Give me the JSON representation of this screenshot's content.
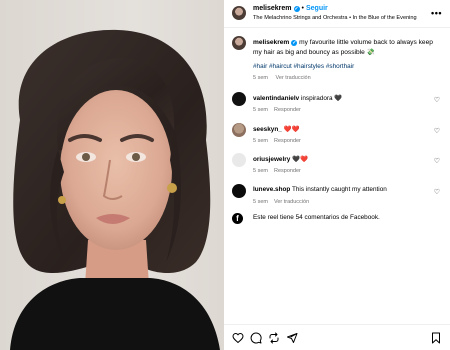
{
  "header": {
    "username": "melisekrem",
    "follow_label": "Seguir",
    "audio": "The Melachrino Strings and Orchestra • In the Blue of the Evening",
    "more_label": "•••"
  },
  "caption": {
    "username": "melisekrem",
    "text": "my favourite little volume back to always keep my hair as big and bouncy as possible 💸",
    "hashtags": "#hair #haircut #hairstyles #shorthair",
    "time": "5 sem",
    "translate": "Ver traducción"
  },
  "comments": [
    {
      "username": "valentindanielv",
      "text": "inspiradora 🖤",
      "time": "5 sem",
      "reply": "Responder"
    },
    {
      "username": "seeskyn_",
      "text": "❤️❤️",
      "time": "5 sem",
      "reply": "Responder"
    },
    {
      "username": "oriusjewelry",
      "text": "🖤❤️",
      "time": "5 sem",
      "reply": "Responder"
    },
    {
      "username": "luneve.shop",
      "text": "This instantly caught my attention",
      "time": "5 sem",
      "reply": "Ver traducción"
    }
  ],
  "facebook": {
    "text": "Este reel tiene 54 comentarios de Facebook."
  },
  "colors": {
    "accent": "#0095f6",
    "hashtag": "#00376b",
    "muted": "#737373"
  }
}
